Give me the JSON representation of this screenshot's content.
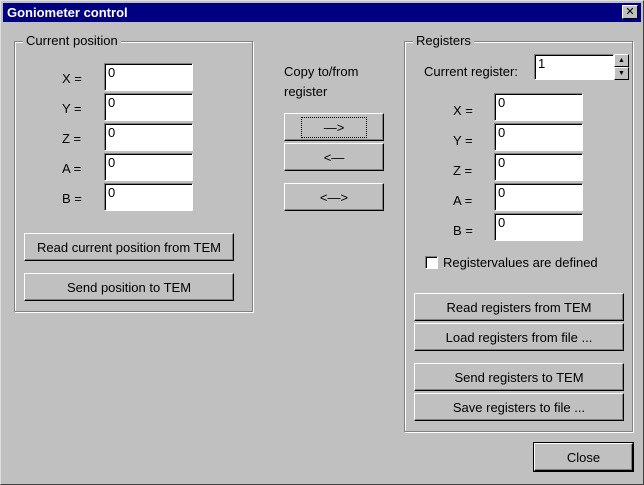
{
  "window": {
    "title": "Goniometer control",
    "close_glyph": "✕"
  },
  "current_position": {
    "legend": "Current position",
    "fields": [
      {
        "label": "X =",
        "value": "0"
      },
      {
        "label": "Y =",
        "value": "0"
      },
      {
        "label": "Z =",
        "value": "0"
      },
      {
        "label": "A =",
        "value": "0"
      },
      {
        "label": "B =",
        "value": "0"
      }
    ],
    "read_button": "Read current position from TEM",
    "send_button": "Send position to TEM"
  },
  "copy": {
    "label_line1": "Copy to/from",
    "label_line2": "register",
    "to_register_glyph": "—>",
    "from_register_glyph": "<—",
    "swap_glyph": "<—>"
  },
  "registers": {
    "legend": "Registers",
    "current_register_label": "Current register:",
    "current_register_value": "1",
    "spin_up_glyph": "▲",
    "spin_down_glyph": "▼",
    "fields": [
      {
        "label": "X =",
        "value": "0"
      },
      {
        "label": "Y =",
        "value": "0"
      },
      {
        "label": "Z =",
        "value": "0"
      },
      {
        "label": "A =",
        "value": "0"
      },
      {
        "label": "B =",
        "value": "0"
      }
    ],
    "defined_checkbox_label": "Registervalues are defined",
    "defined_checked": false,
    "read_button": "Read registers from TEM",
    "load_button": "Load registers from file ...",
    "send_button": "Send registers to TEM",
    "save_button": "Save registers to file ..."
  },
  "close_button": "Close"
}
